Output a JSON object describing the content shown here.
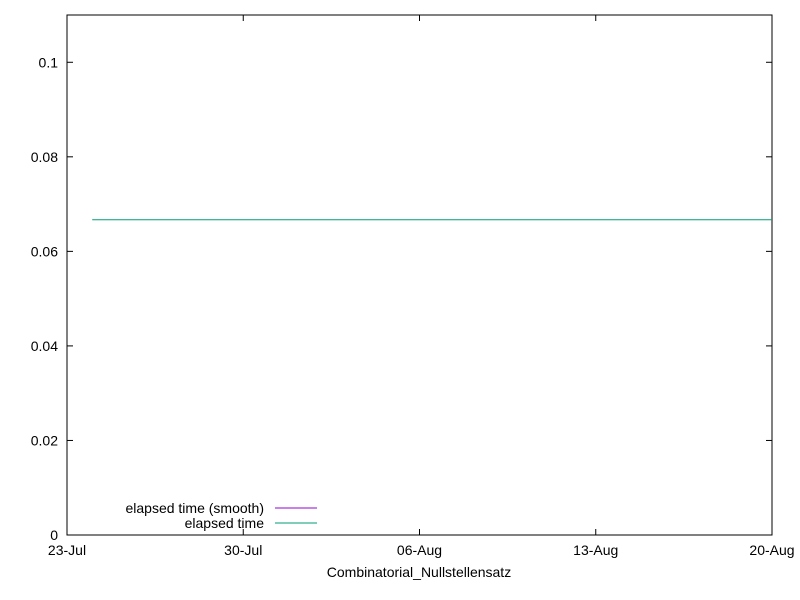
{
  "chart_data": {
    "type": "line",
    "title": "",
    "xlabel": "Combinatorial_Nullstellensatz",
    "ylabel": "",
    "x_ticks": [
      "23-Jul",
      "30-Jul",
      "06-Aug",
      "13-Aug",
      "20-Aug"
    ],
    "x_tick_dates": [
      "2023-07-23",
      "2023-07-30",
      "2023-08-06",
      "2023-08-13",
      "2023-08-20"
    ],
    "xlim": [
      "2023-07-23",
      "2023-08-20"
    ],
    "ylim": [
      0,
      0.11
    ],
    "y_ticks": [
      "0",
      "0.02",
      "0.04",
      "0.06",
      "0.08",
      "0.1"
    ],
    "y_tick_values": [
      0,
      0.02,
      0.04,
      0.06,
      0.08,
      0.1
    ],
    "grid": false,
    "legend_position": "bottom-left",
    "series": [
      {
        "name": "elapsed time (smooth)",
        "color": "#9400d3",
        "points": []
      },
      {
        "name": "elapsed time",
        "color": "#009e73",
        "points": [
          {
            "x": "2023-07-24",
            "y": 0.0667
          },
          {
            "x": "2023-08-20",
            "y": 0.0667
          }
        ]
      }
    ]
  }
}
